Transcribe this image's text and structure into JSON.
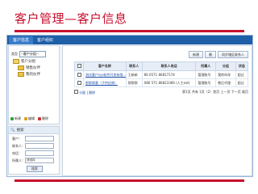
{
  "slide": {
    "title": "客户管理—客户信息"
  },
  "tabs": [
    {
      "label": "客户信息"
    },
    {
      "label": "客户组织"
    }
  ],
  "tree": {
    "filter_label": "类型",
    "filter_value": "--客户分组--",
    "nodes": [
      {
        "label": "客户分组"
      },
      {
        "label": "销售伙伴"
      },
      {
        "label": "我的伙伴"
      }
    ],
    "actions": [
      {
        "label": "新建",
        "color": "#3a9f3a"
      },
      {
        "label": "编辑",
        "color": "#e0a020"
      },
      {
        "label": "删除",
        "color": "#cc3333"
      }
    ]
  },
  "search": {
    "heading": "搜索",
    "fields": [
      {
        "label": "客户："
      },
      {
        "label": "联系人："
      },
      {
        "label": "电话："
      },
      {
        "label": "所属人：",
        "value": "请选择"
      }
    ],
    "button": "搜索"
  },
  "toolbar": {
    "new_label": "新建",
    "delete_label": "删",
    "share_label": "同步辖区联系人"
  },
  "table": {
    "columns": [
      "客户名称",
      "联系人",
      "联系人电话",
      "所属人",
      "分组",
      "状态"
    ],
    "rows": [
      [
        "测试客户sys软件开发有限...",
        "王新新",
        "86 0571 86817174",
        "管理账号",
        "我的伙伴",
        "超过"
      ],
      [
        "那那顾客（子供应商）",
        "那那那",
        "086 571 86823366 (人工ext)",
        "管理账号",
        "售后代理",
        "超过"
      ]
    ]
  },
  "pager": {
    "left_links": [
      "分配",
      "删除"
    ],
    "right_text": "第1页 共有 1页（2）首页 上一页 下一页 尾页"
  }
}
